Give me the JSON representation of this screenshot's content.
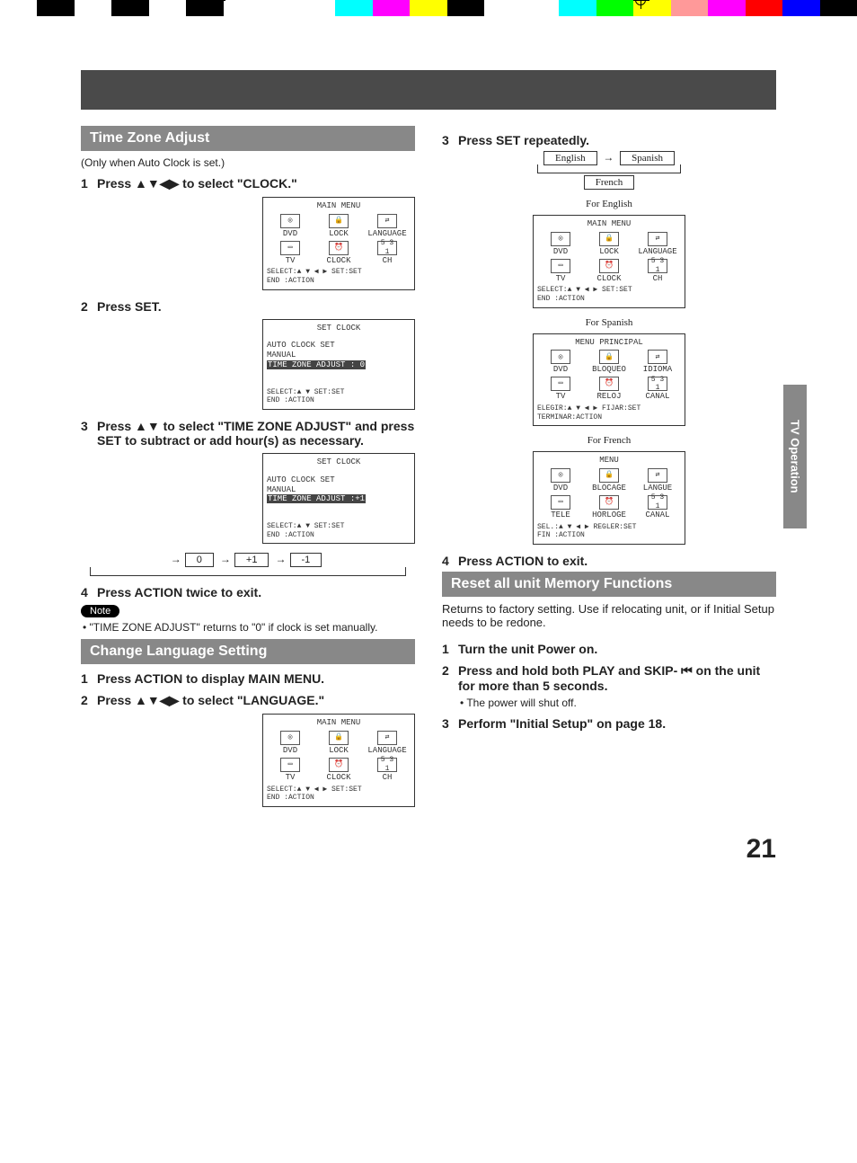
{
  "sideTab": "TV Operation",
  "pageNumber": "21",
  "left": {
    "tz": {
      "header": "Time Zone Adjust",
      "only": "(Only when Auto Clock is set.)",
      "step1": "Press ▲▼◀▶ to select \"CLOCK.\"",
      "step2": "Press SET.",
      "step3": "Press ▲▼ to select \"TIME ZONE ADJUST\" and press SET to subtract or add hour(s) as necessary.",
      "cycle": {
        "a": "0",
        "b": "+1",
        "c": "-1"
      },
      "step4": "Press ACTION twice to exit.",
      "noteLabel": "Note",
      "noteText": "• \"TIME ZONE ADJUST\" returns to \"0\" if clock is set manually."
    },
    "lang": {
      "header": "Change Language Setting",
      "step1": "Press ACTION to display MAIN MENU.",
      "step2": "Press ▲▼◀▶ to select \"LANGUAGE.\""
    },
    "osd": {
      "mainMenu": {
        "title": "MAIN MENU",
        "cells": [
          "DVD",
          "LOCK",
          "LANGUAGE",
          "TV",
          "CLOCK",
          "CH"
        ],
        "foot1": "SELECT:▲ ▼ ◀ ▶  SET:SET",
        "foot2": "END   :ACTION"
      },
      "setClock0": {
        "title": "SET CLOCK",
        "l1": "AUTO CLOCK SET",
        "l2": "MANUAL",
        "l3": "TIME ZONE ADJUST : 0",
        "foot1": "SELECT:▲ ▼      SET:SET",
        "foot2": "END   :ACTION"
      },
      "setClock1": {
        "title": "SET CLOCK",
        "l1": "AUTO CLOCK SET",
        "l2": "MANUAL",
        "l3": "TIME ZONE ADJUST :+1",
        "foot1": "SELECT:▲ ▼      SET:SET",
        "foot2": "END   :ACTION"
      }
    }
  },
  "right": {
    "step3": "Press SET repeatedly.",
    "langCycle": {
      "a": "English",
      "b": "Spanish",
      "c": "French"
    },
    "captions": {
      "en": "For English",
      "es": "For Spanish",
      "fr": "For French"
    },
    "osdEs": {
      "title": "MENU PRINCIPAL",
      "cells": [
        "DVD",
        "BLOQUEO",
        "IDIOMA",
        "TV",
        "RELOJ",
        "CANAL"
      ],
      "foot1": "ELEGIR:▲ ▼ ◀ ▶ FIJAR:SET",
      "foot2": "TERMINAR:ACTION"
    },
    "osdFr": {
      "title": "MENU",
      "cells": [
        "DVD",
        "BLOCAGE",
        "LANGUE",
        "TELE",
        "HORLOGE",
        "CANAL"
      ],
      "foot1": "SEL.:▲ ▼ ◀ ▶ REGLER:SET",
      "foot2": "FIN   :ACTION"
    },
    "step4": "Press ACTION to exit.",
    "reset": {
      "header": "Reset all unit Memory Functions",
      "intro": "Returns to factory setting. Use if relocating unit, or if Initial Setup needs to be redone.",
      "step1": "Turn the unit Power on.",
      "step2": "Press and hold both PLAY and SKIP- ⏮ on the unit for more than 5 seconds.",
      "step2sub": "• The power will shut off.",
      "step3": "Perform \"Initial Setup\" on page 18."
    }
  },
  "icons": {
    "ch": "5 3 1"
  }
}
